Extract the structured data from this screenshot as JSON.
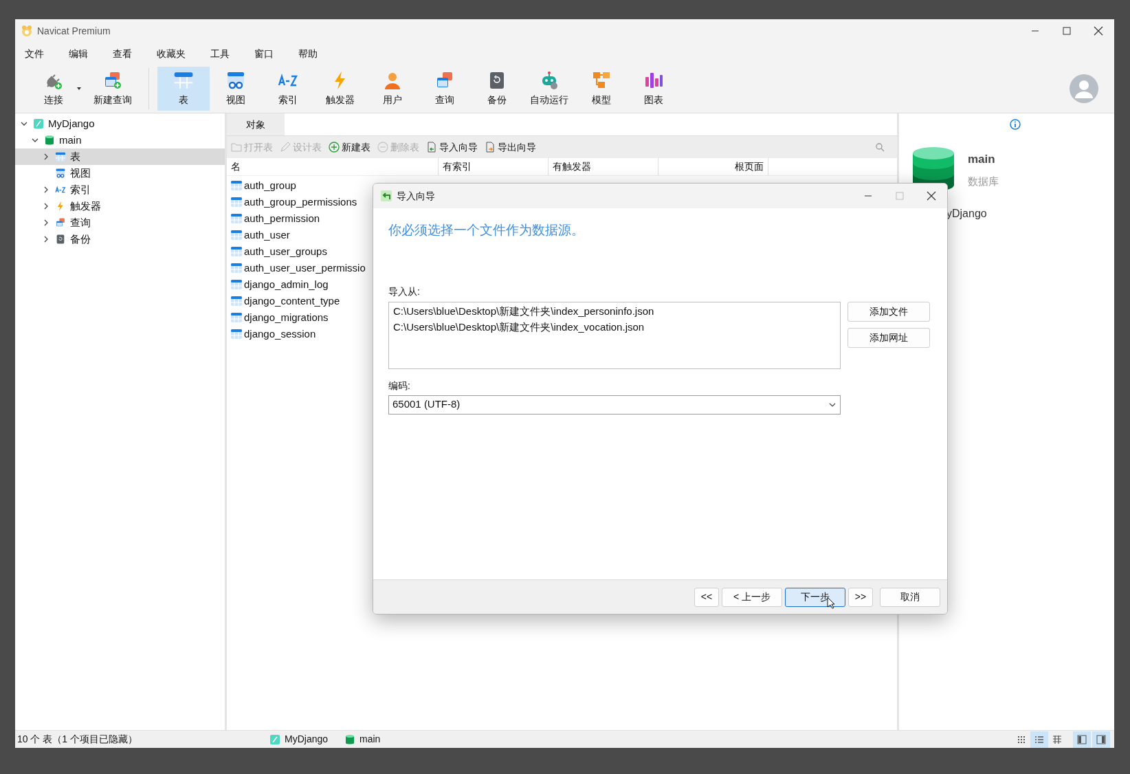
{
  "window": {
    "title": "Navicat Premium"
  },
  "menu": [
    "文件",
    "编辑",
    "查看",
    "收藏夹",
    "工具",
    "窗口",
    "帮助"
  ],
  "toolbar": [
    {
      "kind": "connect",
      "label": "连接",
      "selected": false
    },
    {
      "kind": "newquery",
      "label": "新建查询",
      "selected": false
    },
    {
      "kind": "table",
      "label": "表",
      "selected": true
    },
    {
      "kind": "view",
      "label": "视图",
      "selected": false
    },
    {
      "kind": "index",
      "label": "索引",
      "selected": false
    },
    {
      "kind": "trigger",
      "label": "触发器",
      "selected": false
    },
    {
      "kind": "user",
      "label": "用户",
      "selected": false
    },
    {
      "kind": "query",
      "label": "查询",
      "selected": false
    },
    {
      "kind": "backup",
      "label": "备份",
      "selected": false
    },
    {
      "kind": "robot",
      "label": "自动运行",
      "selected": false
    },
    {
      "kind": "model",
      "label": "模型",
      "selected": false
    },
    {
      "kind": "chart",
      "label": "图表",
      "selected": false
    }
  ],
  "tree": [
    {
      "label": "MyDjango",
      "kind": "connection",
      "expanded": true,
      "selected": false,
      "children": [
        {
          "label": "main",
          "kind": "database",
          "expanded": true,
          "selected": false,
          "children": [
            {
              "label": "表",
              "kind": "table",
              "expanded": false,
              "selected": true
            },
            {
              "label": "视图",
              "kind": "view",
              "selected": false
            },
            {
              "label": "索引",
              "kind": "index",
              "expanded": false,
              "selected": false
            },
            {
              "label": "触发器",
              "kind": "trigger",
              "expanded": false,
              "selected": false
            },
            {
              "label": "查询",
              "kind": "query",
              "expanded": false,
              "selected": false
            },
            {
              "label": "备份",
              "kind": "backup",
              "expanded": false,
              "selected": false
            }
          ]
        }
      ]
    }
  ],
  "tabs": [
    {
      "label": "对象",
      "selected": true
    }
  ],
  "actions": [
    {
      "kind": "open",
      "label": "打开表",
      "disabled": true
    },
    {
      "kind": "design",
      "label": "设计表",
      "disabled": true
    },
    {
      "kind": "new",
      "label": "新建表",
      "disabled": false
    },
    {
      "kind": "delete",
      "label": "删除表",
      "disabled": true
    },
    {
      "kind": "import",
      "label": "导入向导",
      "disabled": false
    },
    {
      "kind": "export",
      "label": "导出向导",
      "disabled": false
    }
  ],
  "table": {
    "columns": [
      "名",
      "有索引",
      "有触发器",
      "根页面"
    ],
    "rows": [
      "auth_group",
      "auth_group_permissions",
      "auth_permission",
      "auth_user",
      "auth_user_groups",
      "auth_user_user_permissio",
      "django_admin_log",
      "django_content_type",
      "django_migrations",
      "django_session"
    ]
  },
  "details": {
    "name": "main",
    "type": "数据库",
    "connection": "yDjango"
  },
  "status_bar": {
    "summary": "10 个 表（1 个项目已隐藏）",
    "connection": "MyDjango",
    "database": "main",
    "views": [
      {
        "kind": "icons",
        "selected": false
      },
      {
        "kind": "list",
        "selected": true
      },
      {
        "kind": "grid",
        "selected": false
      }
    ],
    "panels": [
      {
        "kind": "left",
        "selected": true
      },
      {
        "kind": "right",
        "selected": true
      }
    ]
  },
  "dialog": {
    "title": "导入向导",
    "heading": "你必须选择一个文件作为数据源。",
    "source_label": "导入从:",
    "files": [
      "C:\\Users\\blue\\Desktop\\新建文件夹\\index_personinfo.json",
      "C:\\Users\\blue\\Desktop\\新建文件夹\\index_vocation.json"
    ],
    "side_buttons": [
      "添加文件",
      "添加网址"
    ],
    "encoding_label": "编码:",
    "encoding": "65001 (UTF-8)",
    "nav": [
      {
        "label": "<<",
        "default": false
      },
      {
        "label": "< 上一步",
        "default": false
      },
      {
        "label": "下一步",
        "default": true
      },
      {
        "label": ">>",
        "default": false
      }
    ],
    "cancel": "取消"
  }
}
